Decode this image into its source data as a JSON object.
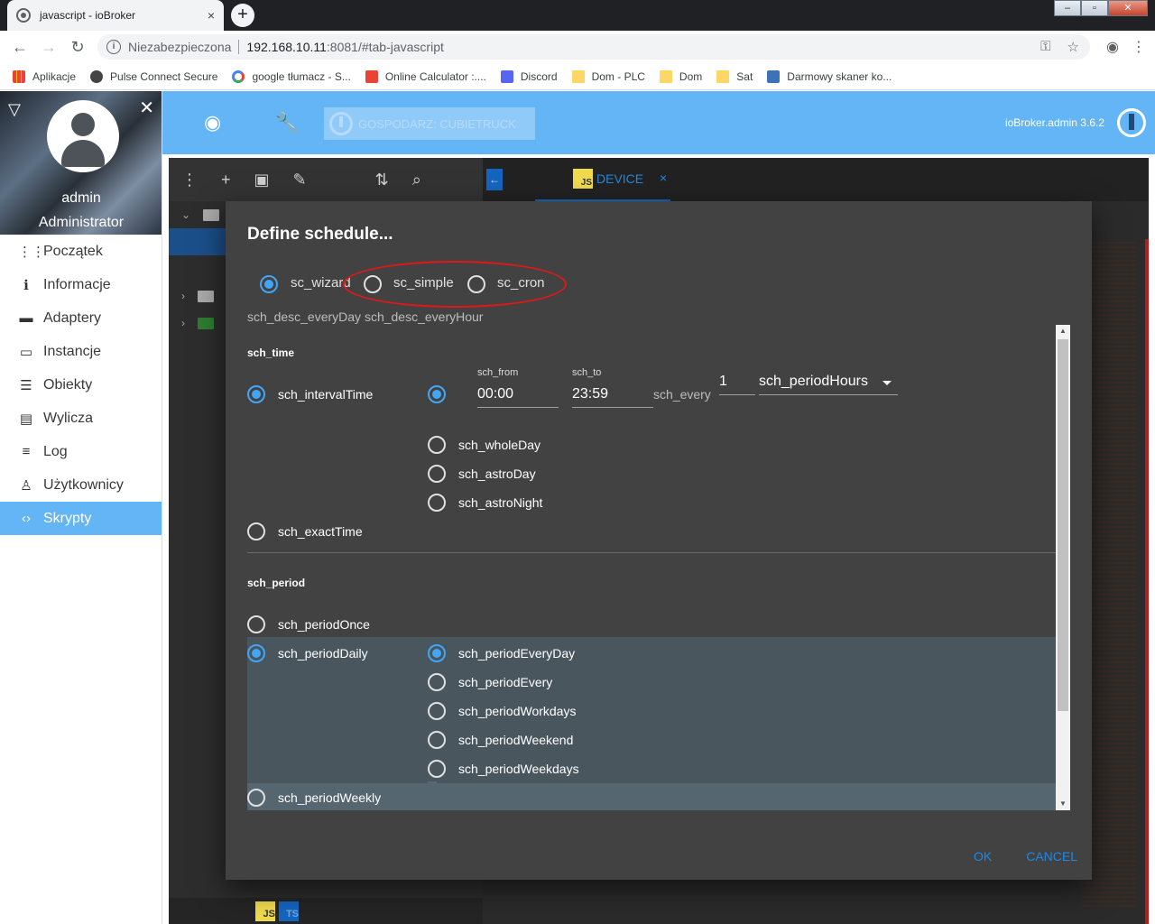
{
  "browser": {
    "tab_title": "javascript - ioBroker",
    "tab_close": "×",
    "new_tab": "+",
    "window_controls": [
      "–",
      "▫",
      "✕"
    ],
    "nav": {
      "back": "←",
      "forward": "→",
      "reload": "↻"
    },
    "insecure_label": "Niezabezpieczona",
    "url_host": "192.168.10.11",
    "url_path": ":8081/#tab-javascript",
    "icons": [
      "key-icon",
      "star-icon",
      "account-icon",
      "menu-dots-icon"
    ],
    "glyphs": {
      "key": "⚿",
      "star": "☆",
      "account": "◉",
      "menu": "⋮",
      "info": "i"
    }
  },
  "bookmarks": [
    {
      "label": "Aplikacje",
      "icon": "apps"
    },
    {
      "label": "Pulse Connect Secure",
      "icon": "pulse"
    },
    {
      "label": "google tłumacz - S...",
      "icon": "g"
    },
    {
      "label": "Online Calculator :....",
      "icon": "calc"
    },
    {
      "label": "Discord",
      "icon": "discord"
    },
    {
      "label": "Dom - PLC",
      "icon": "folder"
    },
    {
      "label": "Dom",
      "icon": "folder"
    },
    {
      "label": "Sat",
      "icon": "folder"
    },
    {
      "label": "Darmowy skaner ko...",
      "icon": "scan"
    }
  ],
  "sidebar": {
    "username": "admin",
    "role": "Administrator",
    "toggle_glyph": "▽",
    "close_glyph": "✕",
    "items": [
      {
        "label": "Początek",
        "icon": "grid-icon",
        "glyph": "⋮⋮",
        "active": false
      },
      {
        "label": "Informacje",
        "icon": "info-icon",
        "glyph": "ℹ",
        "active": false
      },
      {
        "label": "Adaptery",
        "icon": "store-icon",
        "glyph": "▬",
        "active": false
      },
      {
        "label": "Instancje",
        "icon": "keyboard-icon",
        "glyph": "▭",
        "active": false
      },
      {
        "label": "Obiekty",
        "icon": "list-icon",
        "glyph": "☰",
        "active": false
      },
      {
        "label": "Wylicza",
        "icon": "view-list-icon",
        "glyph": "▤",
        "active": false
      },
      {
        "label": "Log",
        "icon": "log-icon",
        "glyph": "≡",
        "active": false
      },
      {
        "label": "Użytkownicy",
        "icon": "user-icon",
        "glyph": "♙",
        "active": false
      },
      {
        "label": "Skrypty",
        "icon": "code-icon",
        "glyph": "‹›",
        "active": true
      }
    ]
  },
  "appbar": {
    "host_label": "GOSPODARZ: CUBIETRUCK",
    "version": "ioBroker.admin 3.6.2",
    "eye_glyph": "◉",
    "wrench_glyph": "🔧"
  },
  "editor": {
    "toolbar_glyphs": [
      "⋮",
      "+",
      "▣",
      "✎",
      "⇅",
      "⌕"
    ],
    "tab_label": "DEVICE",
    "tab_js": "JS",
    "tab_close": "×",
    "back_glyph": "←",
    "tree_expand_glyphs": [
      "⌄",
      "›",
      "›"
    ],
    "bottom_js": "JS",
    "bottom_ts": "TS"
  },
  "dialog": {
    "title": "Define schedule...",
    "modes": [
      {
        "label": "sc_wizard",
        "checked": true
      },
      {
        "label": "sc_simple",
        "checked": false
      },
      {
        "label": "sc_cron",
        "checked": false
      }
    ],
    "description": "sch_desc_everyDay sch_desc_everyHour",
    "time_section": "sch_time",
    "interval_time": "sch_intervalTime",
    "from_label": "sch_from",
    "from_value": "00:00",
    "to_label": "sch_to",
    "to_value": "23:59",
    "every_label": "sch_every",
    "every_value": "1",
    "period_unit": "sch_periodHours",
    "whole_day": "sch_wholeDay",
    "astro_day": "sch_astroDay",
    "astro_night": "sch_astroNight",
    "exact_time": "sch_exactTime",
    "period_section": "sch_period",
    "period_once": "sch_periodOnce",
    "period_daily": "sch_periodDaily",
    "daily_options": [
      {
        "label": "sch_periodEveryDay",
        "checked": true
      },
      {
        "label": "sch_periodEvery",
        "checked": false
      },
      {
        "label": "sch_periodWorkdays",
        "checked": false
      },
      {
        "label": "sch_periodWeekend",
        "checked": false
      },
      {
        "label": "sch_periodWeekdays",
        "checked": false
      }
    ],
    "period_weekly": "sch_periodWeekly",
    "ok": "OK",
    "cancel": "CANCEL",
    "scroll_up": "▲",
    "scroll_down": "▼"
  },
  "colors": {
    "accent": "#64b5f6",
    "dialog_bg": "#424242",
    "radio_checked": "#42a5f5",
    "annotation": "#e01818"
  }
}
